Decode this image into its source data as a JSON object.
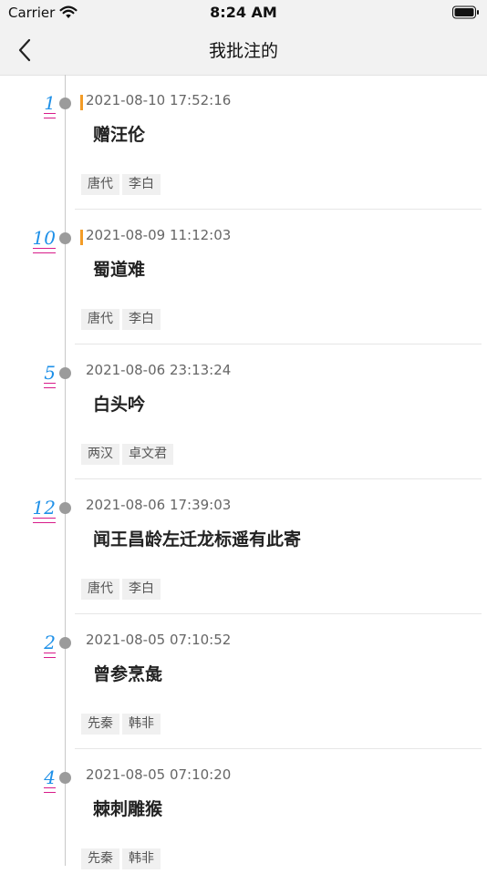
{
  "status_bar": {
    "carrier": "Carrier",
    "time": "8:24 AM"
  },
  "nav": {
    "title": "我批注的"
  },
  "entries": [
    {
      "number": "1",
      "datetime": "2021-08-10 17:52:16",
      "title": "赠汪伦",
      "tags": [
        "唐代",
        "李白"
      ],
      "marked": true
    },
    {
      "number": "10",
      "datetime": "2021-08-09 11:12:03",
      "title": "蜀道难",
      "tags": [
        "唐代",
        "李白"
      ],
      "marked": true
    },
    {
      "number": "5",
      "datetime": "2021-08-06 23:13:24",
      "title": "白头吟",
      "tags": [
        "两汉",
        "卓文君"
      ],
      "marked": false
    },
    {
      "number": "12",
      "datetime": "2021-08-06 17:39:03",
      "title": "闻王昌龄左迁龙标遥有此寄",
      "tags": [
        "唐代",
        "李白"
      ],
      "marked": false
    },
    {
      "number": "2",
      "datetime": "2021-08-05 07:10:52",
      "title": "曾参烹彘",
      "tags": [
        "先秦",
        "韩非"
      ],
      "marked": false
    },
    {
      "number": "4",
      "datetime": "2021-08-05 07:10:20",
      "title": "棘刺雕猴",
      "tags": [
        "先秦",
        "韩非"
      ],
      "marked": false
    }
  ],
  "colors": {
    "accent_number": "#1e90e8",
    "underline": "#d81b8a",
    "marker": "#f39c26",
    "dot": "#9b9b9b"
  }
}
